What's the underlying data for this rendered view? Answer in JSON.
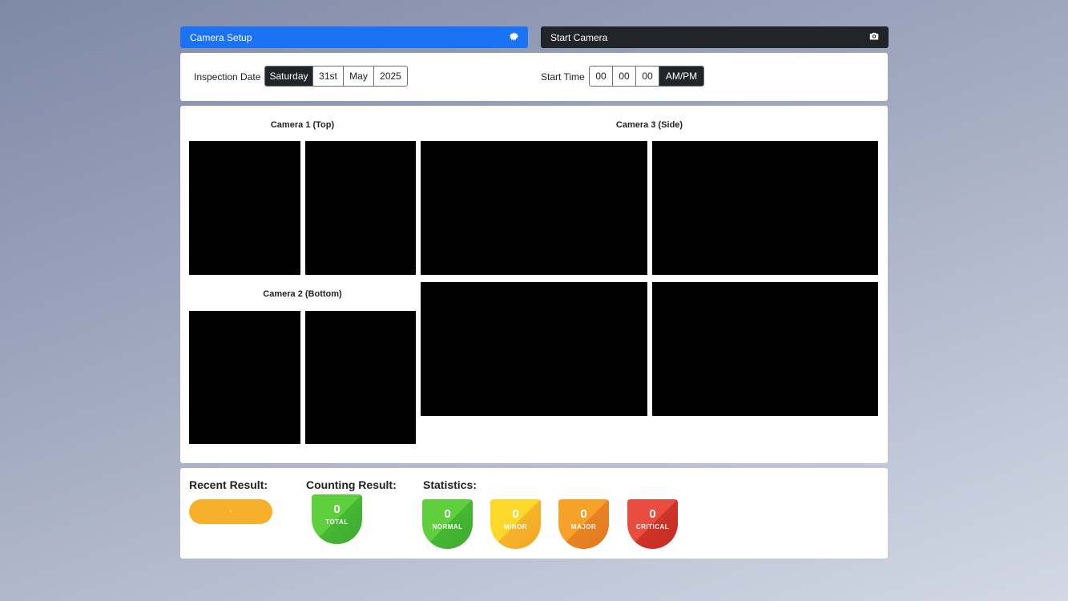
{
  "toolbar": {
    "camera_setup_label": "Camera Setup",
    "camera_setup_icon": "gear-icon",
    "start_camera_label": "Start Camera",
    "start_camera_icon": "camera-icon",
    "setup_color": "#1a73f5",
    "start_color": "#212429"
  },
  "inspection": {
    "date_label": "Inspection Date",
    "day": "Saturday",
    "date": "31st",
    "month": "May",
    "year": "2025",
    "time_label": "Start Time",
    "hour": "00",
    "minute": "00",
    "second": "00",
    "ampm": "AM/PM"
  },
  "cameras": {
    "cam1_title": "Camera 1 (Top)",
    "cam2_title": "Camera 2 (Bottom)",
    "cam3_title": "Camera 3 (Side)"
  },
  "results": {
    "recent_title": "Recent Result:",
    "recent_value": "-",
    "counting_title": "Counting Result:",
    "total_value": "0",
    "total_label": "TOTAL",
    "statistics_title": "Statistics:",
    "stats": [
      {
        "value": "0",
        "label": "NORMAL",
        "color": "#4fc238"
      },
      {
        "value": "0",
        "label": "MINOR",
        "color": "#f9c22a"
      },
      {
        "value": "0",
        "label": "MAJOR",
        "color": "#ee8b25"
      },
      {
        "value": "0",
        "label": "CRITICAL",
        "color": "#dc3f33"
      }
    ]
  }
}
